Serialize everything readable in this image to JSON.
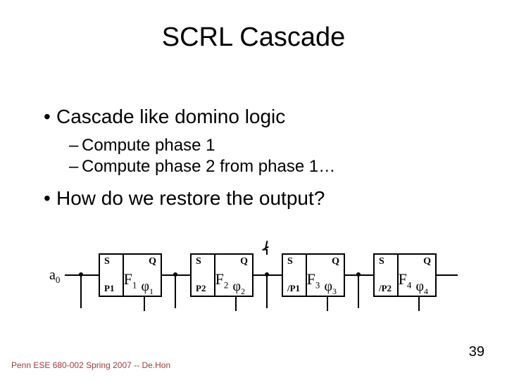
{
  "title": "SCRL Cascade",
  "bullets": {
    "b1": "Cascade like domino logic",
    "b1_sub1": "Compute phase 1",
    "b1_sub2": "Compute phase 2 from phase 1…",
    "b2": "How do we restore the output?"
  },
  "diagram": {
    "input": {
      "base": "a",
      "sub": "0"
    },
    "port_s": "S",
    "port_q": "Q",
    "stages": [
      {
        "f_base": "F",
        "f_sub": "1",
        "p": "P1",
        "phi_base": "φ",
        "phi_sub": "1"
      },
      {
        "f_base": "F",
        "f_sub": "2",
        "p": "P2",
        "phi_base": "φ",
        "phi_sub": "2"
      },
      {
        "f_base": "F",
        "f_sub": "3",
        "p": "/P1",
        "phi_base": "φ",
        "phi_sub": "3"
      },
      {
        "f_base": "F",
        "f_sub": "4",
        "p": "/P2",
        "phi_base": "φ",
        "phi_sub": "4"
      }
    ]
  },
  "footer": "Penn ESE 680-002 Spring 2007 -- De.Hon",
  "pagenum": "39"
}
